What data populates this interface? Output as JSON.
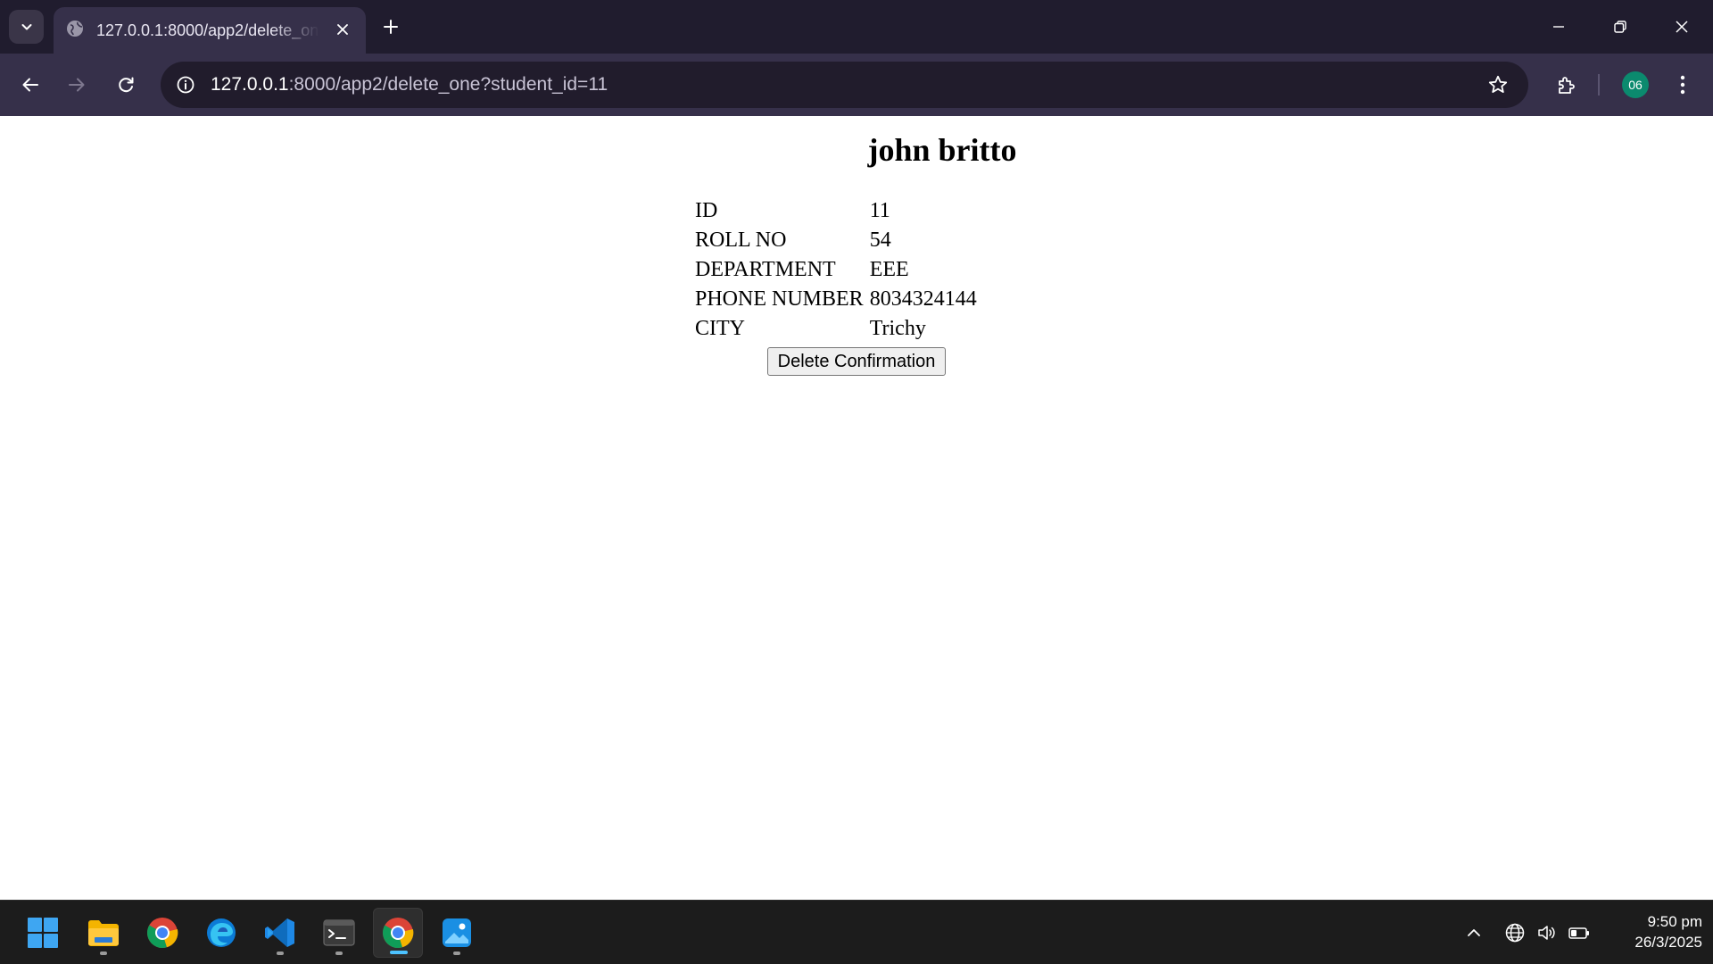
{
  "browser": {
    "tab": {
      "title": "127.0.0.1:8000/app2/delete_one?student_id=11"
    },
    "address_bar": {
      "host": "127.0.0.1",
      "path": ":8000/app2/delete_one?student_id=11"
    },
    "profile": {
      "initials": "06",
      "color": "#0b8a6e"
    }
  },
  "page": {
    "title": "john britto",
    "fields": [
      {
        "label": "ID",
        "value": "11"
      },
      {
        "label": "ROLL NO",
        "value": "54"
      },
      {
        "label": "DEPARTMENT",
        "value": "EEE"
      },
      {
        "label": "PHONE NUMBER",
        "value": "8034324144"
      },
      {
        "label": "CITY",
        "value": "Trichy"
      }
    ],
    "button": {
      "label": "Delete Confirmation"
    }
  },
  "taskbar": {
    "apps": [
      {
        "name": "start-icon"
      },
      {
        "name": "file-explorer-icon"
      },
      {
        "name": "chrome-icon"
      },
      {
        "name": "edge-icon"
      },
      {
        "name": "vscode-icon"
      },
      {
        "name": "terminal-icon"
      },
      {
        "name": "chrome-icon",
        "active": true
      },
      {
        "name": "photos-icon"
      }
    ],
    "clock": {
      "time": "9:50 pm",
      "date": "26/3/2025"
    }
  }
}
